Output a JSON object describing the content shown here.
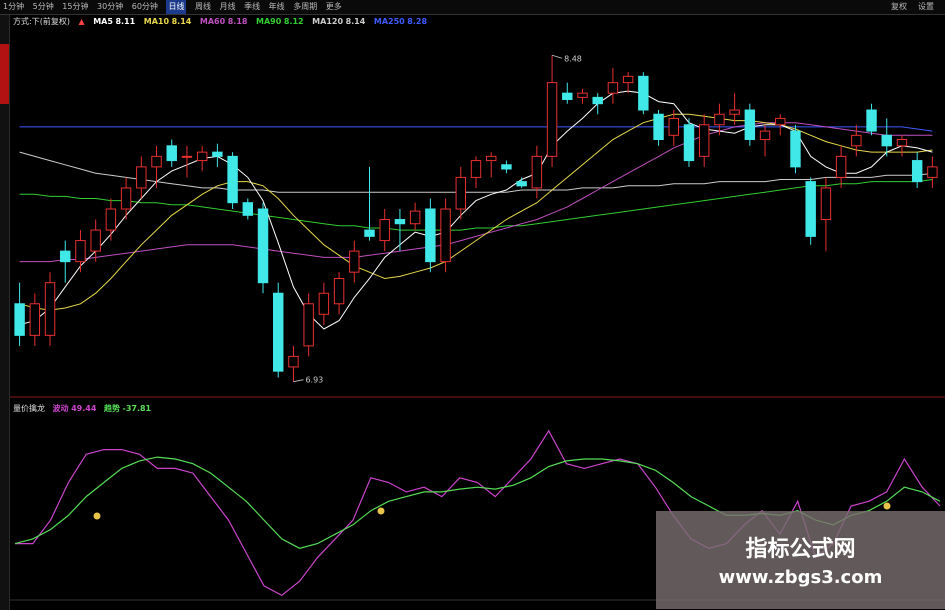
{
  "toolbar": {
    "items": [
      "1分钟",
      "5分钟",
      "15分钟",
      "30分钟",
      "60分钟",
      "日线",
      "周线",
      "月线",
      "季线",
      "年线",
      "多周期",
      "更多"
    ],
    "active": "日线",
    "right_items": [
      "复权",
      "设置"
    ]
  },
  "legend": {
    "title": "方式:下(前复权)",
    "ma": [
      {
        "label": "MA5",
        "value": "8.11",
        "color": "#ffffff"
      },
      {
        "label": "MA10",
        "value": "8.14",
        "color": "#e8d84a"
      },
      {
        "label": "MA60",
        "value": "8.18",
        "color": "#c050c0"
      },
      {
        "label": "MA90",
        "value": "8.12",
        "color": "#32cd32"
      },
      {
        "label": "MA120",
        "value": "8.14",
        "color": "#cccccc"
      },
      {
        "label": "MA250",
        "value": "8.28",
        "color": "#3d5bff"
      }
    ]
  },
  "annotations": {
    "high": "8.48",
    "low": "6.93"
  },
  "indicator": {
    "name": "量价擒龙",
    "series": [
      {
        "label": "波动",
        "value": "49.44",
        "color": "#cc44cc"
      },
      {
        "label": "趋势",
        "value": "-37.81",
        "color": "#55dd55"
      }
    ]
  },
  "watermark": {
    "title": "指标公式网",
    "url": "www.zbgs3.com"
  },
  "colors": {
    "up": "#e83030",
    "down": "#40e8e8",
    "ma5": "#ffffff",
    "ma10": "#e8d84a",
    "ma60": "#c050c0",
    "ma90": "#32cd32",
    "ma120": "#cccccc",
    "ma250": "#3d5bff"
  },
  "chart_data": [
    {
      "type": "candlestick",
      "price_range": [
        6.9,
        8.6
      ],
      "candles": [
        {
          "o": 7.3,
          "h": 7.4,
          "l": 7.1,
          "c": 7.15
        },
        {
          "o": 7.15,
          "h": 7.35,
          "l": 7.1,
          "c": 7.3
        },
        {
          "o": 7.15,
          "h": 7.45,
          "l": 7.1,
          "c": 7.4
        },
        {
          "o": 7.55,
          "h": 7.6,
          "l": 7.4,
          "c": 7.5
        },
        {
          "o": 7.5,
          "h": 7.65,
          "l": 7.45,
          "c": 7.6
        },
        {
          "o": 7.55,
          "h": 7.7,
          "l": 7.5,
          "c": 7.65
        },
        {
          "o": 7.65,
          "h": 7.8,
          "l": 7.6,
          "c": 7.75
        },
        {
          "o": 7.75,
          "h": 7.9,
          "l": 7.7,
          "c": 7.85
        },
        {
          "o": 7.85,
          "h": 8.0,
          "l": 7.8,
          "c": 7.95
        },
        {
          "o": 7.95,
          "h": 8.05,
          "l": 7.85,
          "c": 8.0
        },
        {
          "o": 8.05,
          "h": 8.08,
          "l": 7.95,
          "c": 7.98
        },
        {
          "o": 8.0,
          "h": 8.05,
          "l": 7.9,
          "c": 8.0
        },
        {
          "o": 7.98,
          "h": 8.05,
          "l": 7.93,
          "c": 8.02
        },
        {
          "o": 8.02,
          "h": 8.06,
          "l": 7.95,
          "c": 8.0
        },
        {
          "o": 8.0,
          "h": 8.02,
          "l": 7.75,
          "c": 7.78
        },
        {
          "o": 7.78,
          "h": 7.8,
          "l": 7.7,
          "c": 7.72
        },
        {
          "o": 7.75,
          "h": 7.78,
          "l": 7.35,
          "c": 7.4
        },
        {
          "o": 7.35,
          "h": 7.4,
          "l": 6.95,
          "c": 6.98
        },
        {
          "o": 7.0,
          "h": 7.1,
          "l": 6.93,
          "c": 7.05
        },
        {
          "o": 7.1,
          "h": 7.35,
          "l": 7.05,
          "c": 7.3
        },
        {
          "o": 7.25,
          "h": 7.4,
          "l": 7.2,
          "c": 7.35
        },
        {
          "o": 7.3,
          "h": 7.45,
          "l": 7.25,
          "c": 7.42
        },
        {
          "o": 7.45,
          "h": 7.6,
          "l": 7.4,
          "c": 7.55
        },
        {
          "o": 7.65,
          "h": 7.95,
          "l": 7.6,
          "c": 7.62
        },
        {
          "o": 7.6,
          "h": 7.75,
          "l": 7.55,
          "c": 7.7
        },
        {
          "o": 7.7,
          "h": 7.75,
          "l": 7.55,
          "c": 7.68
        },
        {
          "o": 7.68,
          "h": 7.78,
          "l": 7.65,
          "c": 7.74
        },
        {
          "o": 7.75,
          "h": 7.8,
          "l": 7.45,
          "c": 7.5
        },
        {
          "o": 7.5,
          "h": 7.8,
          "l": 7.45,
          "c": 7.75
        },
        {
          "o": 7.75,
          "h": 7.95,
          "l": 7.7,
          "c": 7.9
        },
        {
          "o": 7.9,
          "h": 8.0,
          "l": 7.85,
          "c": 7.98
        },
        {
          "o": 7.98,
          "h": 8.02,
          "l": 7.9,
          "c": 8.0
        },
        {
          "o": 7.96,
          "h": 7.98,
          "l": 7.92,
          "c": 7.94
        },
        {
          "o": 7.88,
          "h": 7.9,
          "l": 7.85,
          "c": 7.86
        },
        {
          "o": 7.85,
          "h": 8.05,
          "l": 7.8,
          "c": 8.0
        },
        {
          "o": 8.0,
          "h": 8.48,
          "l": 7.95,
          "c": 8.35
        },
        {
          "o": 8.3,
          "h": 8.35,
          "l": 8.25,
          "c": 8.27
        },
        {
          "o": 8.28,
          "h": 8.32,
          "l": 8.25,
          "c": 8.3
        },
        {
          "o": 8.28,
          "h": 8.3,
          "l": 8.2,
          "c": 8.25
        },
        {
          "o": 8.3,
          "h": 8.42,
          "l": 8.25,
          "c": 8.35
        },
        {
          "o": 8.35,
          "h": 8.4,
          "l": 8.3,
          "c": 8.38
        },
        {
          "o": 8.38,
          "h": 8.4,
          "l": 8.2,
          "c": 8.22
        },
        {
          "o": 8.2,
          "h": 8.22,
          "l": 8.05,
          "c": 8.08
        },
        {
          "o": 8.1,
          "h": 8.22,
          "l": 8.05,
          "c": 8.18
        },
        {
          "o": 8.15,
          "h": 8.18,
          "l": 7.95,
          "c": 7.98
        },
        {
          "o": 8.0,
          "h": 8.2,
          "l": 7.95,
          "c": 8.15
        },
        {
          "o": 8.15,
          "h": 8.25,
          "l": 8.1,
          "c": 8.2
        },
        {
          "o": 8.2,
          "h": 8.3,
          "l": 8.15,
          "c": 8.22
        },
        {
          "o": 8.22,
          "h": 8.25,
          "l": 8.05,
          "c": 8.08
        },
        {
          "o": 8.08,
          "h": 8.15,
          "l": 8.0,
          "c": 8.12
        },
        {
          "o": 8.15,
          "h": 8.2,
          "l": 8.1,
          "c": 8.18
        },
        {
          "o": 8.12,
          "h": 8.15,
          "l": 7.92,
          "c": 7.95
        },
        {
          "o": 7.88,
          "h": 7.9,
          "l": 7.58,
          "c": 7.62
        },
        {
          "o": 7.7,
          "h": 7.9,
          "l": 7.55,
          "c": 7.85
        },
        {
          "o": 7.9,
          "h": 8.05,
          "l": 7.85,
          "c": 8.0
        },
        {
          "o": 8.05,
          "h": 8.15,
          "l": 8.0,
          "c": 8.1
        },
        {
          "o": 8.22,
          "h": 8.25,
          "l": 8.1,
          "c": 8.12
        },
        {
          "o": 8.1,
          "h": 8.18,
          "l": 8.0,
          "c": 8.05
        },
        {
          "o": 8.05,
          "h": 8.1,
          "l": 8.0,
          "c": 8.08
        },
        {
          "o": 7.98,
          "h": 8.02,
          "l": 7.85,
          "c": 7.88
        },
        {
          "o": 7.9,
          "h": 8.0,
          "l": 7.85,
          "c": 7.95
        }
      ],
      "ma5": [
        7.2,
        7.22,
        7.28,
        7.38,
        7.48,
        7.55,
        7.63,
        7.72,
        7.8,
        7.88,
        7.93,
        7.96,
        7.99,
        8.0,
        7.96,
        7.9,
        7.79,
        7.59,
        7.38,
        7.25,
        7.18,
        7.22,
        7.33,
        7.42,
        7.52,
        7.58,
        7.64,
        7.62,
        7.64,
        7.72,
        7.79,
        7.82,
        7.84,
        7.89,
        7.92,
        8.05,
        8.12,
        8.18,
        8.25,
        8.3,
        8.31,
        8.3,
        8.26,
        8.25,
        8.16,
        8.13,
        8.12,
        8.11,
        8.14,
        8.15,
        8.15,
        8.12,
        8.0,
        7.95,
        7.92,
        7.92,
        7.95,
        8.02,
        8.05,
        8.04,
        8.02
      ],
      "ma10": [
        7.3,
        7.28,
        7.27,
        7.28,
        7.3,
        7.35,
        7.42,
        7.5,
        7.58,
        7.65,
        7.72,
        7.77,
        7.82,
        7.86,
        7.88,
        7.88,
        7.86,
        7.8,
        7.72,
        7.65,
        7.58,
        7.53,
        7.48,
        7.45,
        7.42,
        7.43,
        7.45,
        7.47,
        7.5,
        7.55,
        7.6,
        7.65,
        7.7,
        7.74,
        7.78,
        7.84,
        7.9,
        7.96,
        8.02,
        8.08,
        8.12,
        8.16,
        8.18,
        8.2,
        8.2,
        8.19,
        8.18,
        8.17,
        8.17,
        8.16,
        8.15,
        8.13,
        8.1,
        8.07,
        8.05,
        8.03,
        8.02,
        8.02,
        8.02,
        8.02,
        8.03
      ],
      "ma60": [
        7.5,
        7.5,
        7.5,
        7.51,
        7.51,
        7.52,
        7.53,
        7.54,
        7.55,
        7.56,
        7.57,
        7.58,
        7.58,
        7.58,
        7.58,
        7.57,
        7.56,
        7.55,
        7.54,
        7.53,
        7.52,
        7.52,
        7.52,
        7.53,
        7.54,
        7.55,
        7.56,
        7.57,
        7.58,
        7.6,
        7.62,
        7.64,
        7.66,
        7.68,
        7.7,
        7.73,
        7.76,
        7.8,
        7.84,
        7.88,
        7.92,
        7.96,
        8.0,
        8.04,
        8.07,
        8.1,
        8.12,
        8.14,
        8.15,
        8.16,
        8.16,
        8.16,
        8.15,
        8.14,
        8.13,
        8.12,
        8.11,
        8.1,
        8.1,
        8.1,
        8.1
      ],
      "ma90": [
        7.82,
        7.82,
        7.81,
        7.81,
        7.8,
        7.8,
        7.79,
        7.79,
        7.78,
        7.78,
        7.77,
        7.77,
        7.76,
        7.75,
        7.74,
        7.73,
        7.72,
        7.71,
        7.7,
        7.69,
        7.68,
        7.67,
        7.67,
        7.66,
        7.66,
        7.65,
        7.65,
        7.65,
        7.65,
        7.65,
        7.66,
        7.66,
        7.67,
        7.67,
        7.68,
        7.69,
        7.7,
        7.71,
        7.72,
        7.73,
        7.74,
        7.75,
        7.76,
        7.77,
        7.78,
        7.79,
        7.8,
        7.81,
        7.82,
        7.83,
        7.84,
        7.85,
        7.86,
        7.86,
        7.87,
        7.87,
        7.88,
        7.88,
        7.88,
        7.88,
        7.89
      ],
      "ma120": [
        8.02,
        8.0,
        7.98,
        7.96,
        7.94,
        7.92,
        7.91,
        7.9,
        7.89,
        7.88,
        7.87,
        7.86,
        7.85,
        7.85,
        7.84,
        7.84,
        7.84,
        7.83,
        7.83,
        7.83,
        7.83,
        7.83,
        7.83,
        7.83,
        7.83,
        7.83,
        7.83,
        7.83,
        7.83,
        7.83,
        7.83,
        7.83,
        7.83,
        7.84,
        7.84,
        7.84,
        7.84,
        7.85,
        7.85,
        7.85,
        7.86,
        7.86,
        7.86,
        7.87,
        7.87,
        7.87,
        7.88,
        7.88,
        7.88,
        7.88,
        7.89,
        7.89,
        7.89,
        7.9,
        7.9,
        7.9,
        7.9,
        7.91,
        7.91,
        7.91,
        7.92
      ],
      "ma250": [
        8.14,
        8.14,
        8.14,
        8.14,
        8.14,
        8.14,
        8.14,
        8.14,
        8.14,
        8.14,
        8.14,
        8.14,
        8.14,
        8.14,
        8.14,
        8.14,
        8.14,
        8.14,
        8.14,
        8.14,
        8.14,
        8.14,
        8.14,
        8.14,
        8.14,
        8.14,
        8.14,
        8.14,
        8.14,
        8.14,
        8.14,
        8.14,
        8.14,
        8.14,
        8.14,
        8.14,
        8.14,
        8.14,
        8.14,
        8.14,
        8.14,
        8.14,
        8.14,
        8.14,
        8.14,
        8.14,
        8.14,
        8.14,
        8.14,
        8.14,
        8.14,
        8.14,
        8.14,
        8.14,
        8.14,
        8.14,
        8.14,
        8.14,
        8.14,
        8.13,
        8.12
      ]
    },
    {
      "type": "line",
      "title": "量价擒龙",
      "y_range": [
        -100,
        100
      ],
      "series": [
        {
          "name": "波动",
          "values": [
            -40,
            -40,
            -15,
            25,
            55,
            60,
            60,
            55,
            40,
            40,
            35,
            10,
            -15,
            -50,
            -85,
            -95,
            -80,
            -55,
            -35,
            -15,
            30,
            25,
            15,
            20,
            10,
            30,
            25,
            10,
            30,
            50,
            80,
            45,
            40,
            45,
            50,
            45,
            20,
            -10,
            -35,
            -45,
            -40,
            -20,
            -5,
            -30,
            5,
            -55,
            -40,
            0,
            5,
            15,
            50,
            20,
            0
          ]
        },
        {
          "name": "趋势",
          "values": [
            -40,
            -35,
            -25,
            -10,
            10,
            25,
            40,
            48,
            52,
            50,
            45,
            35,
            20,
            5,
            -15,
            -35,
            -45,
            -40,
            -30,
            -20,
            -5,
            5,
            10,
            15,
            15,
            18,
            20,
            18,
            22,
            30,
            42,
            48,
            50,
            50,
            48,
            45,
            38,
            25,
            10,
            0,
            -10,
            -10,
            -8,
            -10,
            -5,
            -15,
            -20,
            -10,
            -5,
            5,
            20,
            15,
            5
          ]
        }
      ]
    }
  ]
}
